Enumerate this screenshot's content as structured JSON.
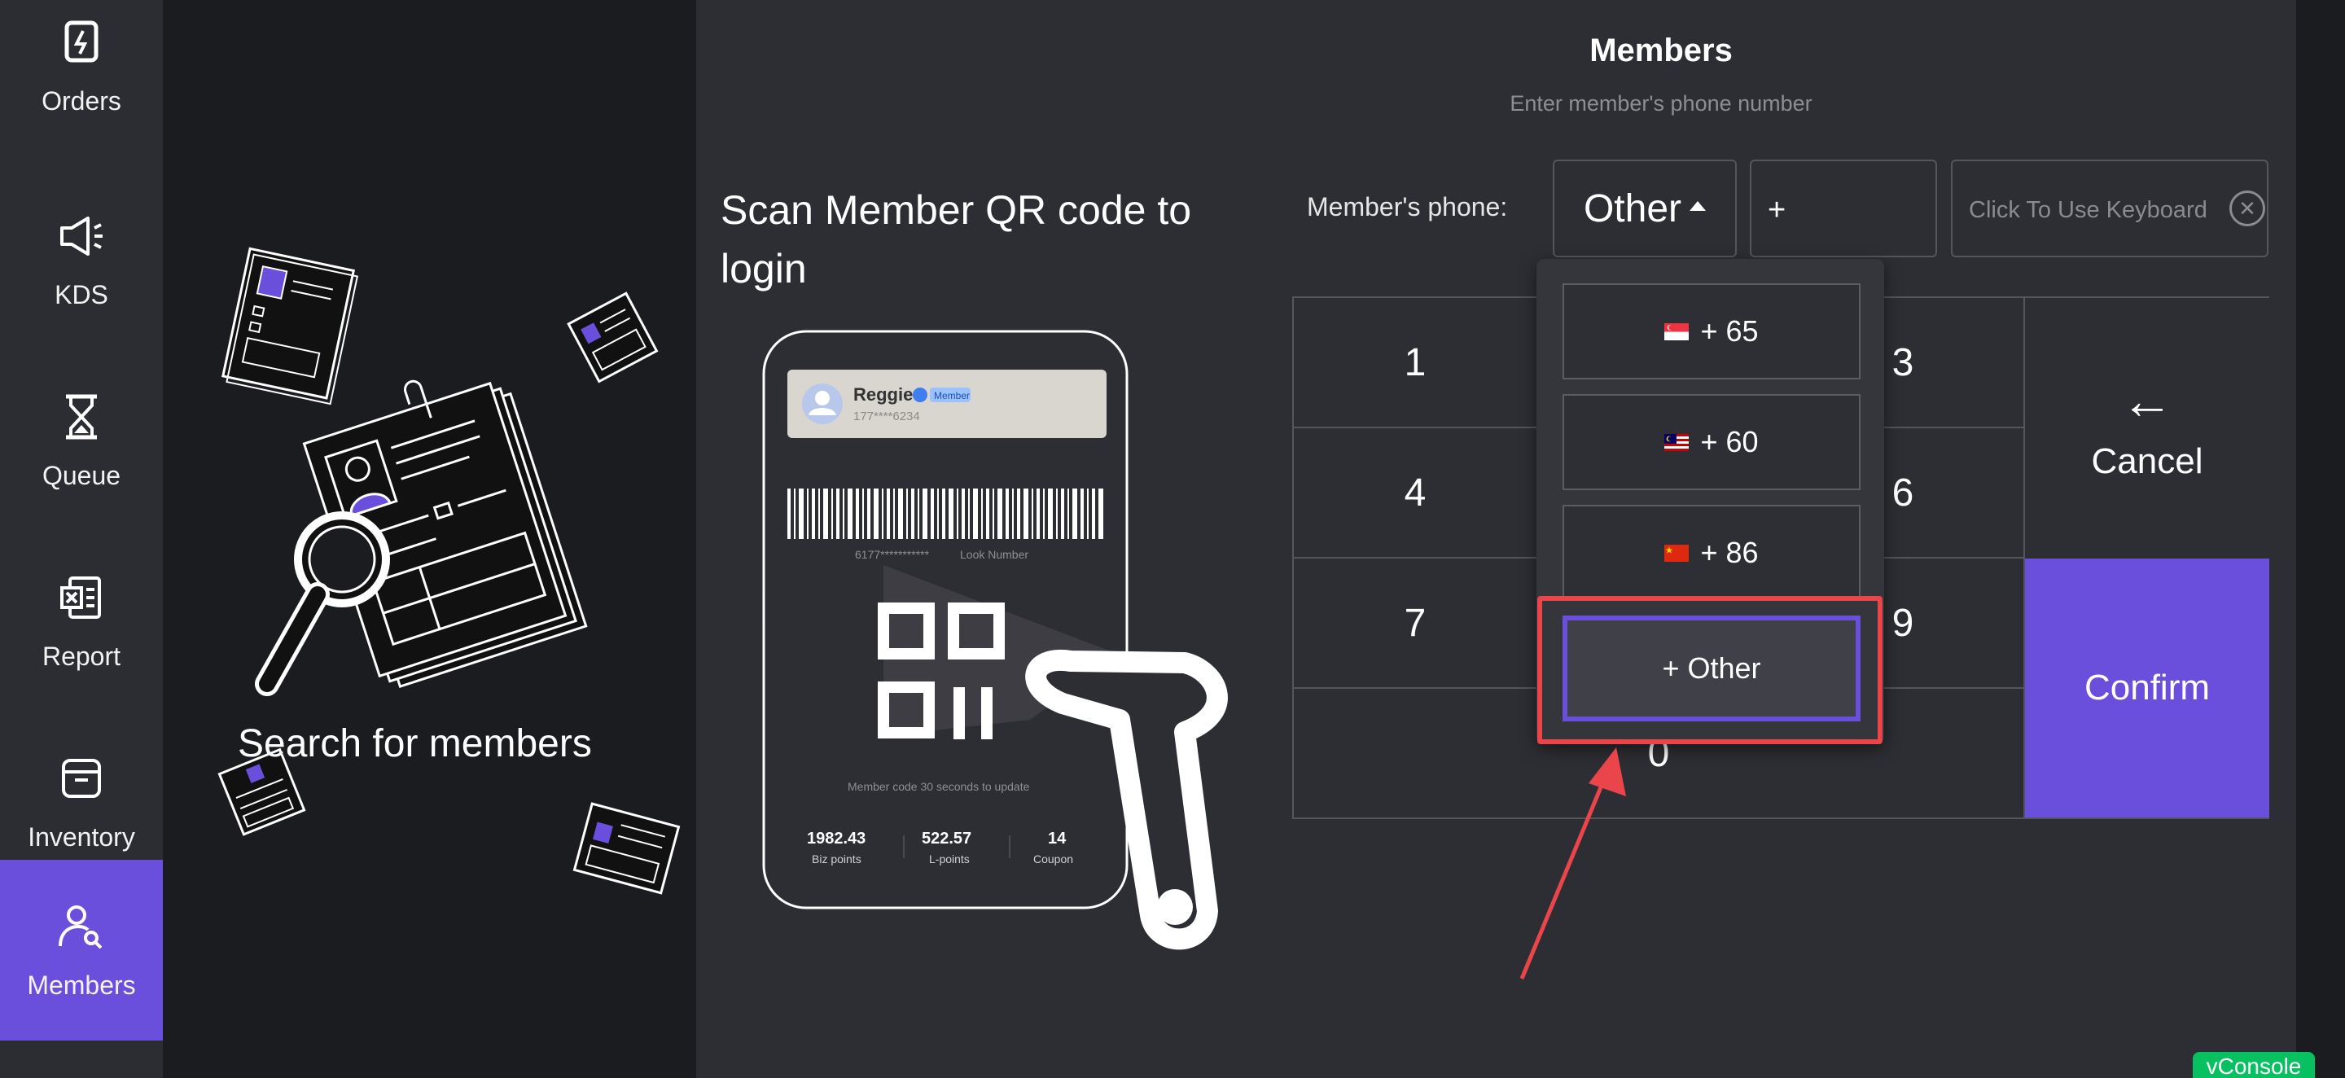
{
  "sidebar": {
    "items": [
      {
        "label": "Orders",
        "icon": "orders-icon"
      },
      {
        "label": "KDS",
        "icon": "speaker-icon"
      },
      {
        "label": "Queue",
        "icon": "hourglass-icon"
      },
      {
        "label": "Report",
        "icon": "report-icon"
      },
      {
        "label": "Inventory",
        "icon": "box-icon"
      },
      {
        "label": "Members",
        "icon": "member-search-icon",
        "active": true
      }
    ]
  },
  "left_panel": {
    "search_title": "Search for members"
  },
  "scan": {
    "title": "Scan Member QR code to login",
    "card": {
      "name": "Reggie",
      "badge": "Member",
      "phone": "177****6234",
      "barcode_number": "6177***********",
      "look_number": "Look Number",
      "update_note": "Member code 30 seconds to update",
      "stats": [
        {
          "value": "1982.43",
          "label": "Biz points"
        },
        {
          "value": "522.57",
          "label": "L-points"
        },
        {
          "value": "14",
          "label": "Coupon"
        }
      ]
    }
  },
  "members": {
    "title": "Members",
    "subtitle": "Enter member's phone number",
    "phone_label": "Member's phone:",
    "country_select_value": "Other",
    "prefix_value": "+",
    "keyboard_placeholder": "Click To Use Keyboard",
    "clear_symbol": "✕"
  },
  "keypad": {
    "keys": [
      "1",
      "3",
      "4",
      "6",
      "7",
      "9",
      "0"
    ],
    "cancel_arrow": "←",
    "cancel_label": "Cancel",
    "confirm_label": "Confirm"
  },
  "dropdown": {
    "options": [
      {
        "label": "+ 65",
        "flag": "singapore"
      },
      {
        "label": "+ 60",
        "flag": "malaysia"
      },
      {
        "label": "+ 86",
        "flag": "china"
      }
    ],
    "other_label": "+ Other"
  },
  "vconsole_label": "vConsole",
  "colors": {
    "accent": "#6a4fdc",
    "highlight": "#e9454a",
    "sidebar_bg": "#2c2d32",
    "panel_bg": "#2d2e33"
  }
}
